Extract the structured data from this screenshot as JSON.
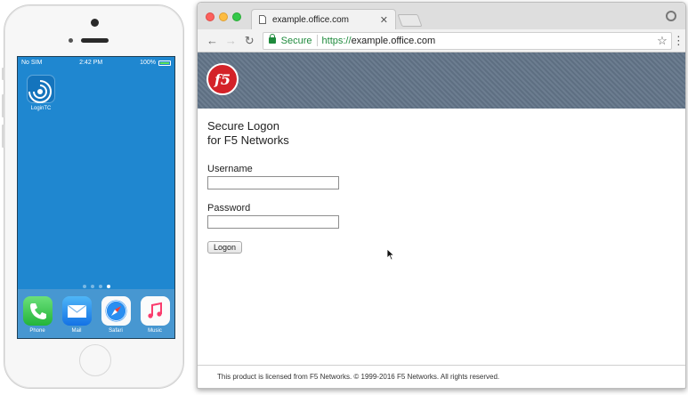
{
  "phone": {
    "status": {
      "carrier": "No SIM",
      "time": "2:42 PM",
      "battery": "100%"
    },
    "apps": [
      {
        "label": "LoginTC",
        "icon": "logintc-icon"
      }
    ],
    "page_dots": {
      "count": 4,
      "active": 4
    },
    "dock": [
      {
        "label": "Phone",
        "icon": "phone-icon"
      },
      {
        "label": "Mail",
        "icon": "mail-icon"
      },
      {
        "label": "Safari",
        "icon": "safari-icon"
      },
      {
        "label": "Music",
        "icon": "music-icon"
      }
    ]
  },
  "browser": {
    "tab_title": "example.office.com",
    "address": {
      "secure_label": "Secure",
      "scheme": "https://",
      "host": "example.office.com"
    },
    "brand_logo_text": "f5",
    "page": {
      "heading_line1": "Secure Logon",
      "heading_line2": "for F5 Networks",
      "username_label": "Username",
      "password_label": "Password",
      "username_value": "",
      "password_value": "",
      "logon_button": "Logon",
      "footer": "This product is licensed from F5 Networks. © 1999-2016 F5 Networks. All rights reserved."
    }
  },
  "colors": {
    "ios_blue": "#1f87d0",
    "f5_red": "#d42228",
    "secure_green": "#1e8a3c"
  }
}
